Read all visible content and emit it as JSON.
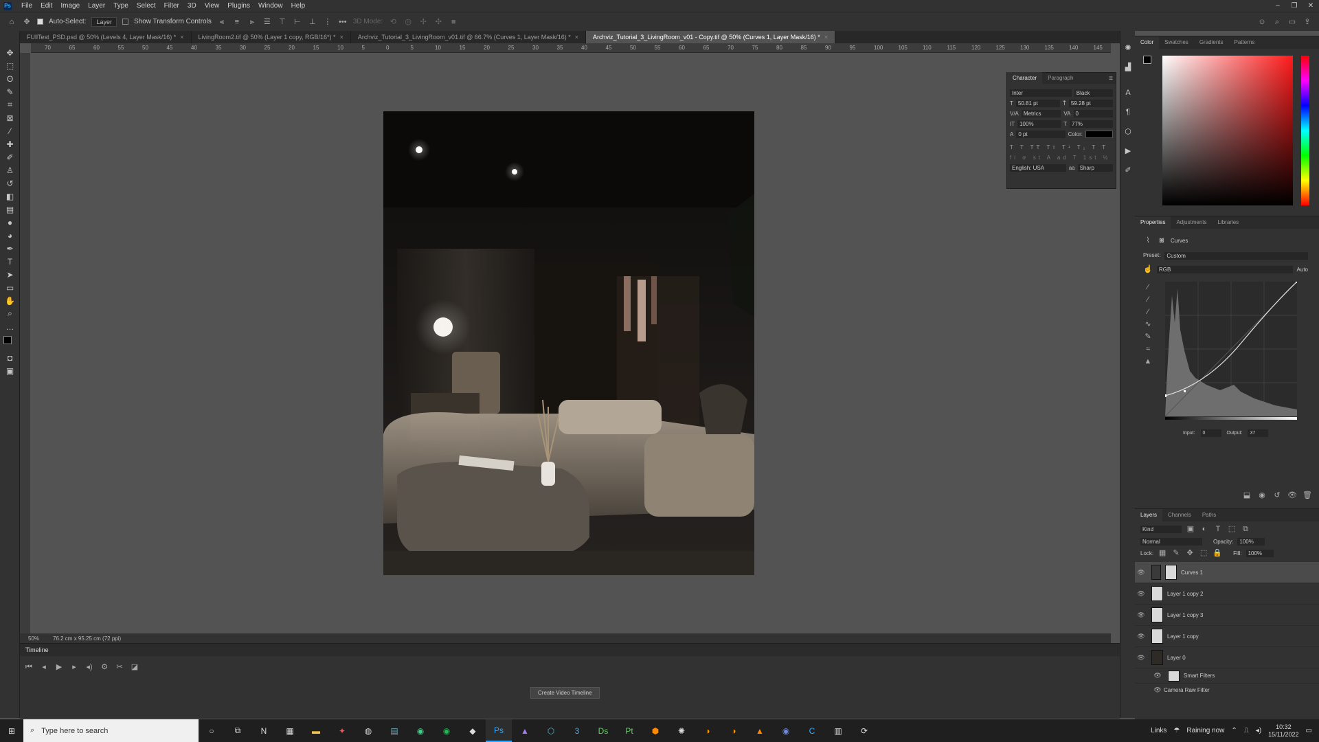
{
  "app": {
    "logo": "Ps"
  },
  "menu": [
    "File",
    "Edit",
    "Image",
    "Layer",
    "Type",
    "Select",
    "Filter",
    "3D",
    "View",
    "Plugins",
    "Window",
    "Help"
  ],
  "options": {
    "auto_select_label": "Auto-Select:",
    "auto_select_target": "Layer",
    "transform_label": "Show Transform Controls",
    "mode_3d": "3D Mode:"
  },
  "tabs": [
    {
      "label": "FUllTest_PSD.psd @ 50% (Levels 4, Layer Mask/16) *"
    },
    {
      "label": "LivingRoom2.tif @ 50% (Layer 1 copy, RGB/16*) *"
    },
    {
      "label": "Archviz_Tutorial_3_LivingRoom_v01.tif @ 66.7% (Curves 1, Layer Mask/16) *"
    },
    {
      "label": "Archviz_Tutorial_3_LivingRoom_v01 - Copy.tif @ 50% (Curves 1, Layer Mask/16) *"
    }
  ],
  "ruler_ticks": [
    "70",
    "65",
    "60",
    "55",
    "50",
    "45",
    "40",
    "35",
    "30",
    "25",
    "20",
    "15",
    "10",
    "5",
    "0",
    "5",
    "10",
    "15",
    "20",
    "25",
    "30",
    "35",
    "40",
    "45",
    "50",
    "55",
    "60",
    "65",
    "70",
    "75",
    "80",
    "85",
    "90",
    "95",
    "100",
    "105",
    "110",
    "115",
    "120",
    "125",
    "130",
    "135",
    "140",
    "145"
  ],
  "status": {
    "zoom": "50%",
    "doc_size": "76.2 cm x 95.25 cm (72 ppi)"
  },
  "timeline": {
    "title": "Timeline",
    "create_button": "Create Video Timeline"
  },
  "character": {
    "tabs": [
      "Character",
      "Paragraph"
    ],
    "font": "Inter",
    "style": "Black",
    "size": "50.81 pt",
    "leading": "59.28 pt",
    "kerning": "Metrics",
    "tracking": "0",
    "vscale": "100%",
    "hscale": "77%",
    "baseline": "0 pt",
    "color_label": "Color:",
    "language": "English: USA",
    "aa_icon_label": "aa",
    "antialias": "Sharp"
  },
  "color_panel": {
    "tabs": [
      "Color",
      "Swatches",
      "Gradients",
      "Patterns"
    ]
  },
  "properties": {
    "tabs": [
      "Properties",
      "Adjustments",
      "Libraries"
    ],
    "adjustment": "Curves",
    "preset_label": "Preset:",
    "preset": "Custom",
    "channel": "RGB",
    "auto_label": "Auto",
    "input_label": "Input:",
    "input": "0",
    "output_label": "Output:",
    "output": "37"
  },
  "layers_panel": {
    "tabs": [
      "Layers",
      "Channels",
      "Paths"
    ],
    "kind": "Kind",
    "blend": "Normal",
    "opacity_label": "Opacity:",
    "opacity": "100%",
    "lock_label": "Lock:",
    "fill_label": "Fill:",
    "fill": "100%",
    "layers": [
      {
        "name": "Curves 1"
      },
      {
        "name": "Layer 1 copy 2"
      },
      {
        "name": "Layer 1 copy 3"
      },
      {
        "name": "Layer 1 copy"
      },
      {
        "name": "Layer 0"
      }
    ],
    "smart_filters": "Smart Filters",
    "camera_raw": "Camera Raw Filter"
  },
  "taskbar": {
    "search_placeholder": "Type here to search",
    "links": "Links",
    "weather": "Raining now",
    "time": "10:32",
    "date": "15/11/2022"
  }
}
